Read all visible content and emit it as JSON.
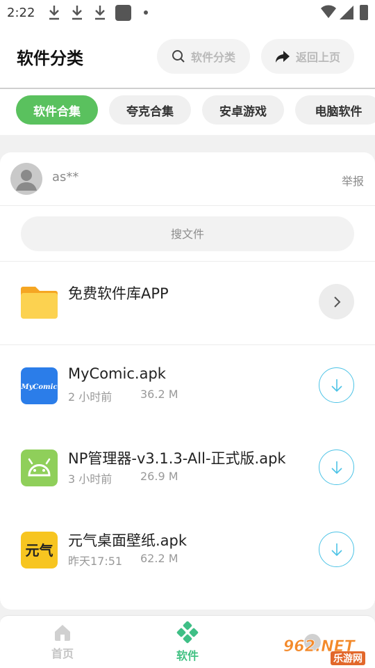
{
  "status_bar": {
    "time": "2:22"
  },
  "header": {
    "title": "软件分类",
    "search_label": "软件分类",
    "back_label": "返回上页"
  },
  "tabs": [
    {
      "label": "软件合集",
      "active": true
    },
    {
      "label": "夸克合集",
      "active": false
    },
    {
      "label": "安卓游戏",
      "active": false
    },
    {
      "label": "电脑软件",
      "active": false
    }
  ],
  "card": {
    "user_name": "as**",
    "report_label": "举报",
    "search_placeholder": "搜文件",
    "folder": {
      "name": "免费软件库APP"
    },
    "files": [
      {
        "name": "MyComic.apk",
        "time": "2 小时前",
        "size": "36.2 M",
        "icon_text": "MyComic"
      },
      {
        "name": "NP管理器-v3.1.3-All-正式版.apk",
        "time": "3 小时前",
        "size": "26.9 M"
      },
      {
        "name": "元气桌面壁纸.apk",
        "time": "昨天17:51",
        "size": "62.2 M",
        "icon_text": "元气"
      }
    ]
  },
  "bottom_nav": {
    "home_label": "首页",
    "software_label": "软件"
  },
  "watermark": {
    "logo_text": "962.NET",
    "sub_text": "乐游网"
  },
  "colors": {
    "accent_green": "#5ac15e",
    "nav_active": "#42c183",
    "download_blue": "#4cc3e6"
  }
}
